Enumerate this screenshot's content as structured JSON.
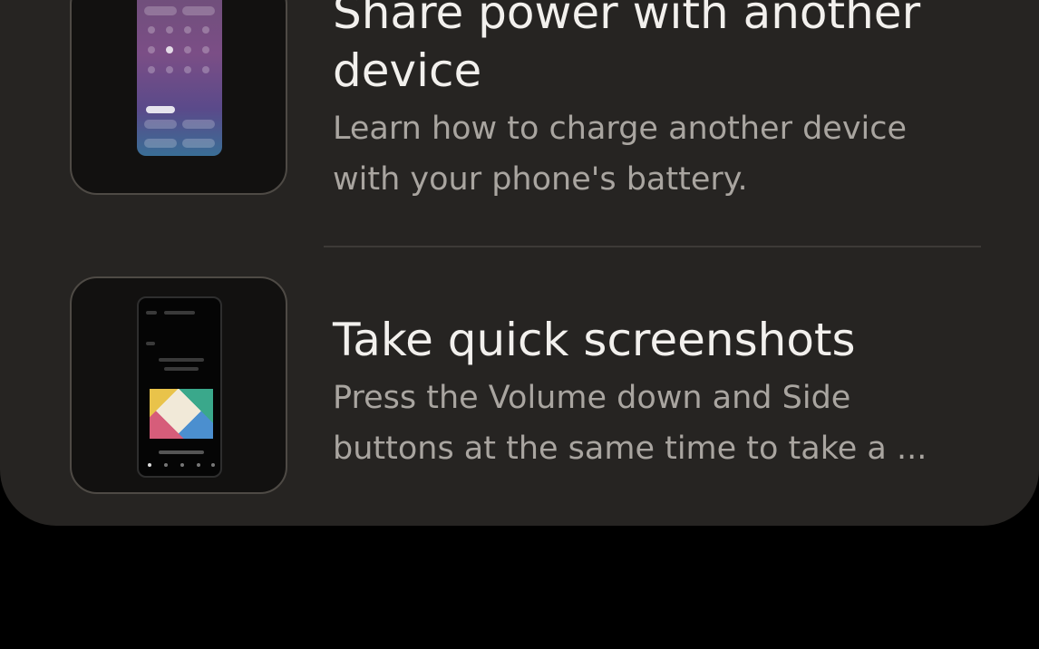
{
  "items": [
    {
      "title": "Share power with another device",
      "title_line1": "Share power with another",
      "title_line2": "device",
      "desc_line1": "Learn how to charge another device",
      "desc_line2": "with your phone's battery.",
      "thumbnail": "wireless-powershare-screen"
    },
    {
      "title": "Take quick screenshots",
      "desc_line1": "Press the Volume down and Side",
      "desc_line2": "buttons at the same time to take a ...",
      "thumbnail": "screenshot-screen"
    }
  ],
  "colors": {
    "background": "#000000",
    "card": "#262422",
    "title": "#f2f0ed",
    "description": "#a9a5a0",
    "divider": "#3d3a37"
  }
}
